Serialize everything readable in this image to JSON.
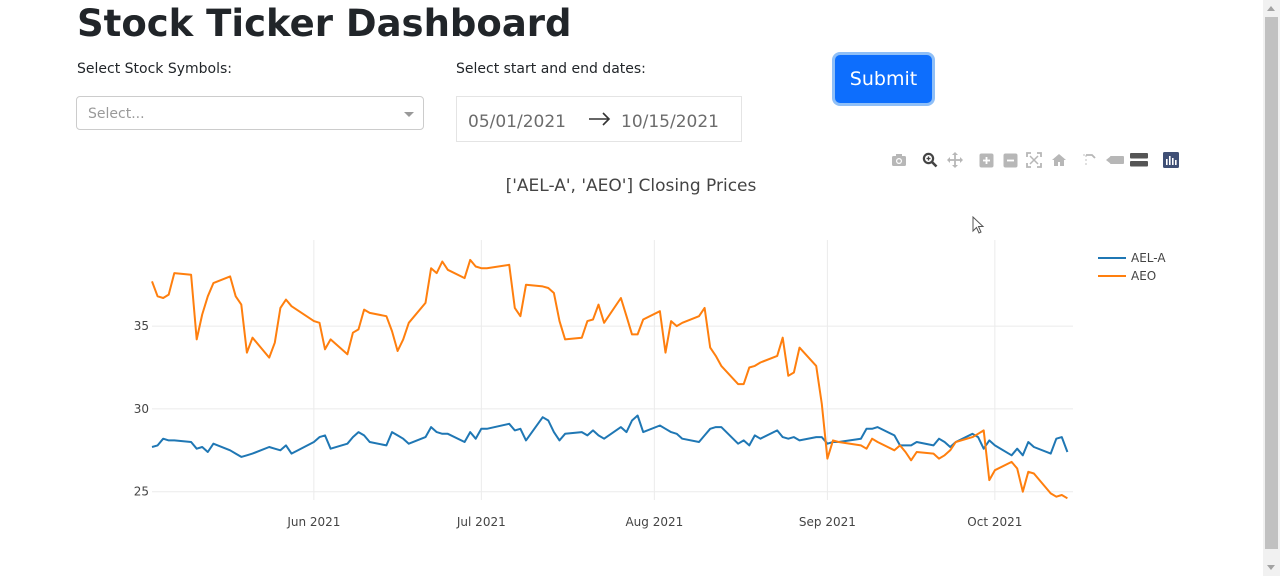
{
  "page": {
    "title": "Stock Ticker Dashboard"
  },
  "controls": {
    "symbols_label": "Select Stock Symbols:",
    "symbols_placeholder": "Select...",
    "dates_label": "Select start and end dates:",
    "start_date": "05/01/2021",
    "end_date": "10/15/2021",
    "submit_label": "Submit"
  },
  "modebar": {
    "icons": [
      "camera-icon",
      "zoom-icon",
      "pan-icon",
      "zoom-in-icon",
      "zoom-out-icon",
      "autoscale-icon",
      "reset-axes-icon",
      "spike-lines-icon",
      "hover-closest-icon",
      "hover-compare-icon",
      "plotly-logo-icon"
    ]
  },
  "colors": {
    "accent": "#0d6efd",
    "series_ael": "#1f77b4",
    "series_aeo": "#ff7f0e"
  },
  "chart_data": {
    "type": "line",
    "title": "['AEL-A', 'AEO'] Closing Prices",
    "xlabel": "",
    "ylabel": "",
    "x_ticks": [
      "Jun 2021",
      "Jul 2021",
      "Aug 2021",
      "Sep 2021",
      "Oct 2021"
    ],
    "y_ticks": [
      25,
      30,
      35
    ],
    "ylim": [
      24.5,
      40.2
    ],
    "x_range": [
      "2021-05-03",
      "2021-10-15"
    ],
    "grid": true,
    "legend_position": "top-right",
    "series": [
      {
        "name": "AEL-A",
        "color": "#1f77b4",
        "points": [
          [
            "2021-05-03",
            27.7
          ],
          [
            "2021-05-04",
            27.8
          ],
          [
            "2021-05-05",
            28.2
          ],
          [
            "2021-05-06",
            28.1
          ],
          [
            "2021-05-07",
            28.1
          ],
          [
            "2021-05-10",
            28.0
          ],
          [
            "2021-05-11",
            27.6
          ],
          [
            "2021-05-12",
            27.7
          ],
          [
            "2021-05-13",
            27.4
          ],
          [
            "2021-05-14",
            27.9
          ],
          [
            "2021-05-17",
            27.5
          ],
          [
            "2021-05-18",
            27.3
          ],
          [
            "2021-05-19",
            27.1
          ],
          [
            "2021-05-20",
            27.2
          ],
          [
            "2021-05-21",
            27.3
          ],
          [
            "2021-05-24",
            27.7
          ],
          [
            "2021-05-25",
            27.6
          ],
          [
            "2021-05-26",
            27.5
          ],
          [
            "2021-05-27",
            27.8
          ],
          [
            "2021-05-28",
            27.3
          ],
          [
            "2021-06-01",
            28.0
          ],
          [
            "2021-06-02",
            28.3
          ],
          [
            "2021-06-03",
            28.4
          ],
          [
            "2021-06-04",
            27.6
          ],
          [
            "2021-06-07",
            27.9
          ],
          [
            "2021-06-08",
            28.3
          ],
          [
            "2021-06-09",
            28.6
          ],
          [
            "2021-06-10",
            28.4
          ],
          [
            "2021-06-11",
            28.0
          ],
          [
            "2021-06-14",
            27.8
          ],
          [
            "2021-06-15",
            28.6
          ],
          [
            "2021-06-16",
            28.4
          ],
          [
            "2021-06-17",
            28.2
          ],
          [
            "2021-06-18",
            27.9
          ],
          [
            "2021-06-21",
            28.3
          ],
          [
            "2021-06-22",
            28.9
          ],
          [
            "2021-06-23",
            28.6
          ],
          [
            "2021-06-24",
            28.5
          ],
          [
            "2021-06-25",
            28.5
          ],
          [
            "2021-06-28",
            28.0
          ],
          [
            "2021-06-29",
            28.6
          ],
          [
            "2021-06-30",
            28.2
          ],
          [
            "2021-07-01",
            28.8
          ],
          [
            "2021-07-02",
            28.8
          ],
          [
            "2021-07-06",
            29.1
          ],
          [
            "2021-07-07",
            28.7
          ],
          [
            "2021-07-08",
            28.8
          ],
          [
            "2021-07-09",
            28.1
          ],
          [
            "2021-07-12",
            29.5
          ],
          [
            "2021-07-13",
            29.3
          ],
          [
            "2021-07-14",
            28.6
          ],
          [
            "2021-07-15",
            28.1
          ],
          [
            "2021-07-16",
            28.5
          ],
          [
            "2021-07-19",
            28.6
          ],
          [
            "2021-07-20",
            28.4
          ],
          [
            "2021-07-21",
            28.7
          ],
          [
            "2021-07-22",
            28.4
          ],
          [
            "2021-07-23",
            28.2
          ],
          [
            "2021-07-26",
            28.9
          ],
          [
            "2021-07-27",
            28.6
          ],
          [
            "2021-07-28",
            29.3
          ],
          [
            "2021-07-29",
            29.6
          ],
          [
            "2021-07-30",
            28.6
          ],
          [
            "2021-08-02",
            29.0
          ],
          [
            "2021-08-03",
            28.8
          ],
          [
            "2021-08-04",
            28.6
          ],
          [
            "2021-08-05",
            28.5
          ],
          [
            "2021-08-06",
            28.2
          ],
          [
            "2021-08-09",
            28.0
          ],
          [
            "2021-08-10",
            28.4
          ],
          [
            "2021-08-11",
            28.8
          ],
          [
            "2021-08-12",
            28.9
          ],
          [
            "2021-08-13",
            28.9
          ],
          [
            "2021-08-16",
            27.9
          ],
          [
            "2021-08-17",
            28.1
          ],
          [
            "2021-08-18",
            27.8
          ],
          [
            "2021-08-19",
            28.4
          ],
          [
            "2021-08-20",
            28.2
          ],
          [
            "2021-08-23",
            28.7
          ],
          [
            "2021-08-24",
            28.3
          ],
          [
            "2021-08-25",
            28.2
          ],
          [
            "2021-08-26",
            28.3
          ],
          [
            "2021-08-27",
            28.1
          ],
          [
            "2021-08-30",
            28.3
          ],
          [
            "2021-08-31",
            28.3
          ],
          [
            "2021-09-01",
            27.9
          ],
          [
            "2021-09-02",
            28.0
          ],
          [
            "2021-09-03",
            28.0
          ],
          [
            "2021-09-07",
            28.2
          ],
          [
            "2021-09-08",
            28.8
          ],
          [
            "2021-09-09",
            28.8
          ],
          [
            "2021-09-10",
            28.9
          ],
          [
            "2021-09-13",
            28.4
          ],
          [
            "2021-09-14",
            27.8
          ],
          [
            "2021-09-15",
            27.8
          ],
          [
            "2021-09-16",
            27.8
          ],
          [
            "2021-09-17",
            28.0
          ],
          [
            "2021-09-20",
            27.8
          ],
          [
            "2021-09-21",
            28.2
          ],
          [
            "2021-09-22",
            28.0
          ],
          [
            "2021-09-23",
            27.7
          ],
          [
            "2021-09-24",
            28.0
          ],
          [
            "2021-09-27",
            28.5
          ],
          [
            "2021-09-28",
            28.3
          ],
          [
            "2021-09-29",
            27.6
          ],
          [
            "2021-09-30",
            28.1
          ],
          [
            "2021-10-01",
            27.8
          ],
          [
            "2021-10-04",
            27.2
          ],
          [
            "2021-10-05",
            27.6
          ],
          [
            "2021-10-06",
            27.2
          ],
          [
            "2021-10-07",
            28.0
          ],
          [
            "2021-10-08",
            27.7
          ],
          [
            "2021-10-11",
            27.3
          ],
          [
            "2021-10-12",
            28.2
          ],
          [
            "2021-10-13",
            28.3
          ],
          [
            "2021-10-14",
            27.4
          ]
        ]
      },
      {
        "name": "AEO",
        "color": "#ff7f0e",
        "points": [
          [
            "2021-05-03",
            37.7
          ],
          [
            "2021-05-04",
            36.8
          ],
          [
            "2021-05-05",
            36.7
          ],
          [
            "2021-05-06",
            36.9
          ],
          [
            "2021-05-07",
            38.2
          ],
          [
            "2021-05-10",
            38.1
          ],
          [
            "2021-05-11",
            34.2
          ],
          [
            "2021-05-12",
            35.7
          ],
          [
            "2021-05-13",
            36.8
          ],
          [
            "2021-05-14",
            37.6
          ],
          [
            "2021-05-17",
            38.0
          ],
          [
            "2021-05-18",
            36.8
          ],
          [
            "2021-05-19",
            36.3
          ],
          [
            "2021-05-20",
            33.4
          ],
          [
            "2021-05-21",
            34.3
          ],
          [
            "2021-05-24",
            33.1
          ],
          [
            "2021-05-25",
            34.0
          ],
          [
            "2021-05-26",
            36.1
          ],
          [
            "2021-05-27",
            36.6
          ],
          [
            "2021-05-28",
            36.2
          ],
          [
            "2021-06-01",
            35.3
          ],
          [
            "2021-06-02",
            35.2
          ],
          [
            "2021-06-03",
            33.6
          ],
          [
            "2021-06-04",
            34.2
          ],
          [
            "2021-06-07",
            33.3
          ],
          [
            "2021-06-08",
            34.6
          ],
          [
            "2021-06-09",
            34.8
          ],
          [
            "2021-06-10",
            36.0
          ],
          [
            "2021-06-11",
            35.8
          ],
          [
            "2021-06-14",
            35.6
          ],
          [
            "2021-06-15",
            34.7
          ],
          [
            "2021-06-16",
            33.5
          ],
          [
            "2021-06-17",
            34.2
          ],
          [
            "2021-06-18",
            35.2
          ],
          [
            "2021-06-21",
            36.4
          ],
          [
            "2021-06-22",
            38.5
          ],
          [
            "2021-06-23",
            38.2
          ],
          [
            "2021-06-24",
            38.9
          ],
          [
            "2021-06-25",
            38.4
          ],
          [
            "2021-06-28",
            37.9
          ],
          [
            "2021-06-29",
            39.0
          ],
          [
            "2021-06-30",
            38.6
          ],
          [
            "2021-07-01",
            38.5
          ],
          [
            "2021-07-02",
            38.5
          ],
          [
            "2021-07-06",
            38.7
          ],
          [
            "2021-07-07",
            36.1
          ],
          [
            "2021-07-08",
            35.6
          ],
          [
            "2021-07-09",
            37.5
          ],
          [
            "2021-07-12",
            37.4
          ],
          [
            "2021-07-13",
            37.3
          ],
          [
            "2021-07-14",
            37.0
          ],
          [
            "2021-07-15",
            35.3
          ],
          [
            "2021-07-16",
            34.2
          ],
          [
            "2021-07-19",
            34.3
          ],
          [
            "2021-07-20",
            35.3
          ],
          [
            "2021-07-21",
            35.4
          ],
          [
            "2021-07-22",
            36.3
          ],
          [
            "2021-07-23",
            35.2
          ],
          [
            "2021-07-26",
            36.7
          ],
          [
            "2021-07-27",
            35.6
          ],
          [
            "2021-07-28",
            34.5
          ],
          [
            "2021-07-29",
            34.5
          ],
          [
            "2021-07-30",
            35.4
          ],
          [
            "2021-08-02",
            35.9
          ],
          [
            "2021-08-03",
            33.4
          ],
          [
            "2021-08-04",
            35.3
          ],
          [
            "2021-08-05",
            35.0
          ],
          [
            "2021-08-06",
            35.2
          ],
          [
            "2021-08-09",
            35.6
          ],
          [
            "2021-08-10",
            36.1
          ],
          [
            "2021-08-11",
            33.7
          ],
          [
            "2021-08-12",
            33.2
          ],
          [
            "2021-08-13",
            32.6
          ],
          [
            "2021-08-16",
            31.5
          ],
          [
            "2021-08-17",
            31.5
          ],
          [
            "2021-08-18",
            32.5
          ],
          [
            "2021-08-19",
            32.6
          ],
          [
            "2021-08-20",
            32.8
          ],
          [
            "2021-08-23",
            33.2
          ],
          [
            "2021-08-24",
            34.3
          ],
          [
            "2021-08-25",
            32.0
          ],
          [
            "2021-08-26",
            32.2
          ],
          [
            "2021-08-27",
            33.7
          ],
          [
            "2021-08-30",
            32.6
          ],
          [
            "2021-08-31",
            30.3
          ],
          [
            "2021-09-01",
            27.0
          ],
          [
            "2021-09-02",
            28.1
          ],
          [
            "2021-09-03",
            28.0
          ],
          [
            "2021-09-07",
            27.8
          ],
          [
            "2021-09-08",
            27.6
          ],
          [
            "2021-09-09",
            28.2
          ],
          [
            "2021-09-10",
            28.0
          ],
          [
            "2021-09-13",
            27.5
          ],
          [
            "2021-09-14",
            27.8
          ],
          [
            "2021-09-15",
            27.4
          ],
          [
            "2021-09-16",
            26.9
          ],
          [
            "2021-09-17",
            27.4
          ],
          [
            "2021-09-20",
            27.3
          ],
          [
            "2021-09-21",
            27.0
          ],
          [
            "2021-09-22",
            27.2
          ],
          [
            "2021-09-23",
            27.5
          ],
          [
            "2021-09-24",
            28.0
          ],
          [
            "2021-09-27",
            28.3
          ],
          [
            "2021-09-28",
            28.5
          ],
          [
            "2021-09-29",
            28.7
          ],
          [
            "2021-09-30",
            25.7
          ],
          [
            "2021-10-01",
            26.3
          ],
          [
            "2021-10-04",
            26.8
          ],
          [
            "2021-10-05",
            26.4
          ],
          [
            "2021-10-06",
            25.0
          ],
          [
            "2021-10-07",
            26.2
          ],
          [
            "2021-10-08",
            26.1
          ],
          [
            "2021-10-11",
            24.9
          ],
          [
            "2021-10-12",
            24.7
          ],
          [
            "2021-10-13",
            24.8
          ],
          [
            "2021-10-14",
            24.6
          ]
        ]
      }
    ]
  }
}
